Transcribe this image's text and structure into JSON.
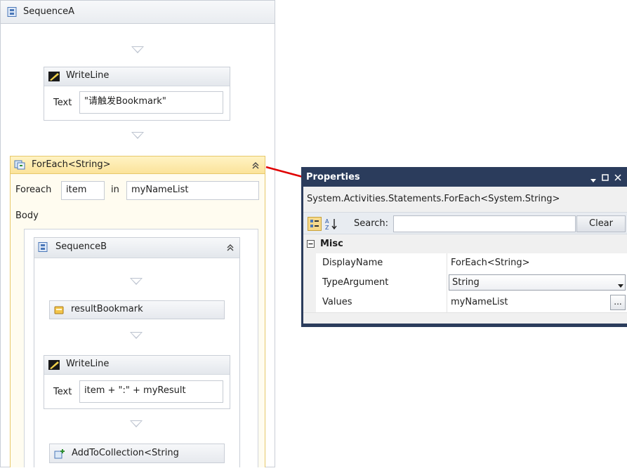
{
  "sequence_a": {
    "title": "SequenceA"
  },
  "writeline_1": {
    "title": "WriteLine",
    "text_label": "Text",
    "text_value": "\"请触发Bookmark\""
  },
  "foreach": {
    "title": "ForEach<String>",
    "foreach_label": "Foreach",
    "item_value": "item",
    "in_label": "in",
    "values_value": "myNameList",
    "body_label": "Body"
  },
  "sequence_b": {
    "title": "SequenceB"
  },
  "result_bookmark": {
    "title": "resultBookmark"
  },
  "writeline_2": {
    "title": "WriteLine",
    "text_label": "Text",
    "text_value": "item + \":\" + myResult"
  },
  "add_to_collection": {
    "title": "AddToCollection<String"
  },
  "properties": {
    "title": "Properties",
    "type_name": "System.Activities.Statements.ForEach<System.String>",
    "search_label": "Search:",
    "search_value": "",
    "clear_label": "Clear",
    "category": "Misc",
    "rows": [
      {
        "name": "DisplayName",
        "value": "ForEach<String>"
      },
      {
        "name": "TypeArgument",
        "value": "String"
      },
      {
        "name": "Values",
        "value": "myNameList"
      }
    ],
    "ellipsis_label": "..."
  },
  "colors": {
    "foreach_border": "#e7c86a",
    "foreach_header": "#fbe39a",
    "properties_title": "#2b3c5c",
    "connector": "#e00000"
  }
}
